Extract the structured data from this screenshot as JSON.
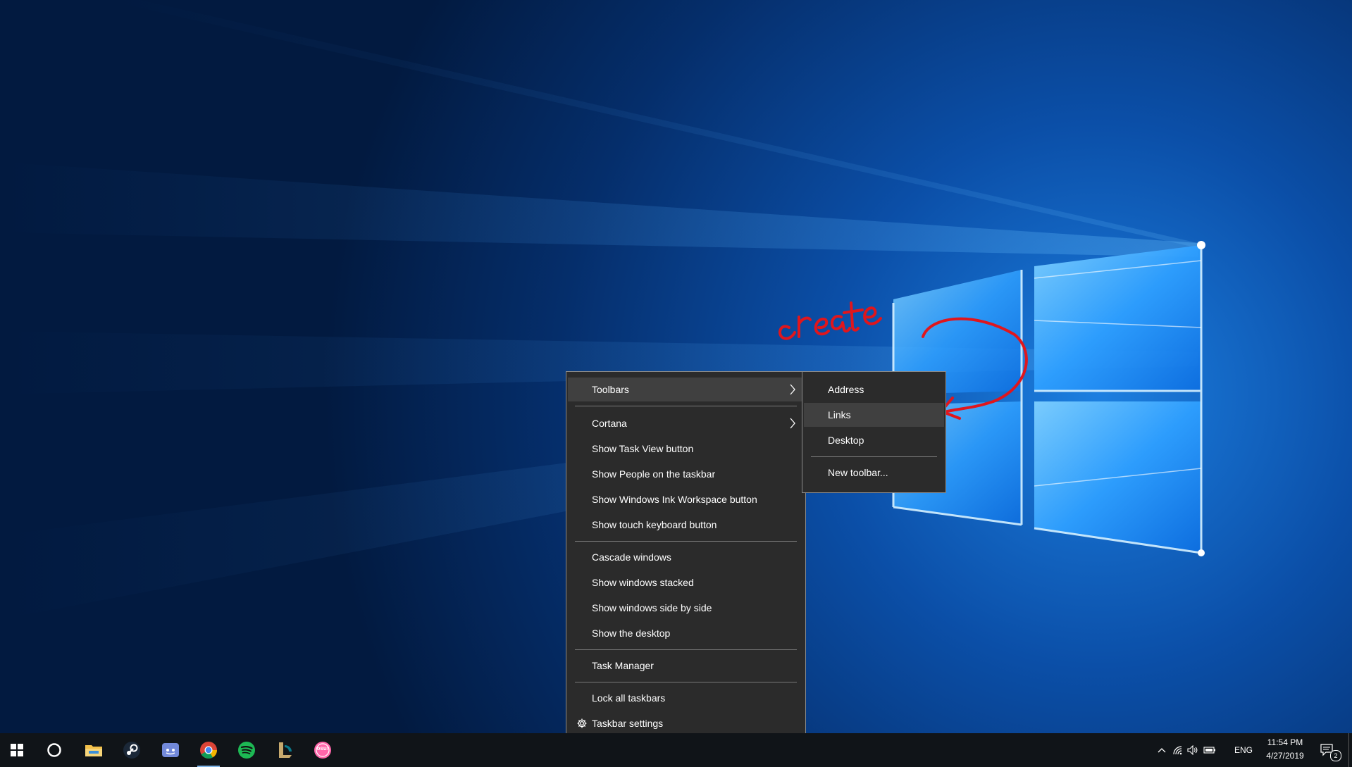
{
  "main_menu": {
    "items": [
      {
        "label": "Toolbars"
      },
      {
        "label": "Cortana"
      },
      {
        "label": "Show Task View button"
      },
      {
        "label": "Show People on the taskbar"
      },
      {
        "label": "Show Windows Ink Workspace button"
      },
      {
        "label": "Show touch keyboard button"
      },
      {
        "label": "Cascade windows"
      },
      {
        "label": "Show windows stacked"
      },
      {
        "label": "Show windows side by side"
      },
      {
        "label": "Show the desktop"
      },
      {
        "label": "Task Manager"
      },
      {
        "label": "Lock all taskbars"
      },
      {
        "label": "Taskbar settings"
      }
    ]
  },
  "submenu": {
    "items": [
      {
        "label": "Address"
      },
      {
        "label": "Links"
      },
      {
        "label": "Desktop"
      },
      {
        "label": "New toolbar..."
      }
    ]
  },
  "annotation": {
    "text": "create"
  },
  "taskbar": {
    "icons": [
      "windows-start-icon",
      "cortana-icon",
      "file-explorer-icon",
      "steam-icon",
      "discord-icon",
      "chrome-icon",
      "spotify-icon",
      "league-of-legends-icon",
      "osu-icon"
    ],
    "osu_label": "osu!",
    "tray": {
      "language": "ENG",
      "time": "11:54 PM",
      "date": "4/27/2019",
      "notification_count": "2"
    }
  },
  "colors": {
    "menu_bg": "#2b2b2b",
    "menu_highlight": "#404040",
    "taskbar_bg": "#101418",
    "annotation": "#e0161d",
    "desktop_glow": "#3fb0ff"
  }
}
